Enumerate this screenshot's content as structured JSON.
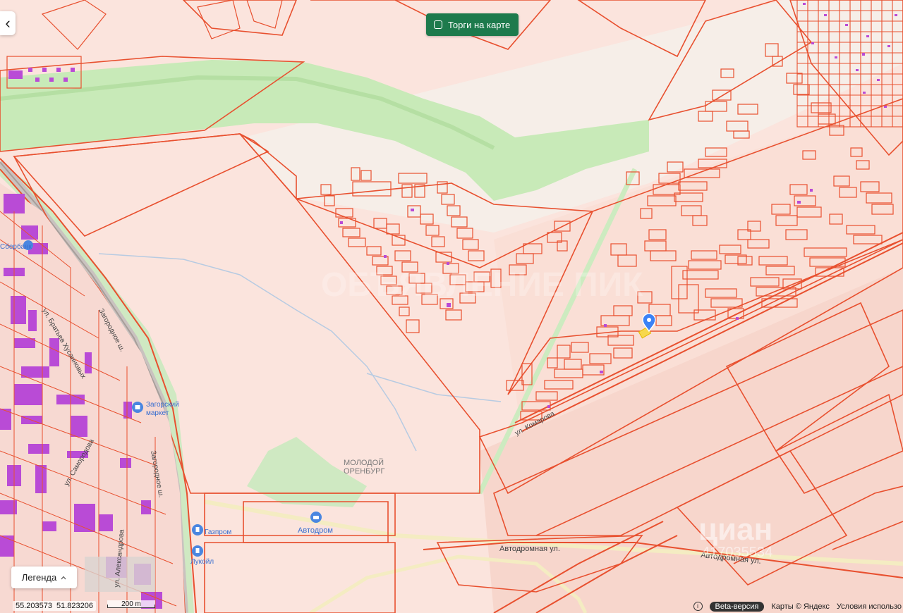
{
  "controls": {
    "auction_toggle_label": "Торги на карте",
    "legend_label": "Легенда",
    "back_symbol": "‹"
  },
  "status": {
    "lat": "55.203573",
    "lon": "51.823206",
    "scale_label": "200 m",
    "beta_label": "Beta-версия",
    "attribution": "Карты © Яндекс",
    "terms": "Условия использо"
  },
  "labels": {
    "district": [
      "МОЛОДОЙ",
      "ОРЕНБУРГ"
    ],
    "avtodrom": "Автодром",
    "avtodromnaya_1": "Автодромная ул.",
    "avtodromnaya_2": "Автодромная ул.",
    "komarova": "ул. Комарова",
    "zagorodnoe": "Загородное ш.",
    "zagorodnoe_2": "Загородное ш.",
    "bratsev": "ул. Братьев Хусаиновых",
    "aleksandrova": "ул. Александрова",
    "samorodova": "ул. Самородова",
    "zagorsky_1": "Загорский",
    "zagorsky_2": "маркет",
    "gazprom": "Газпром",
    "lukoil": "Лукойл",
    "bank": "Сбербанк",
    "cian": "циан",
    "cian_id": "417035534",
    "watermark": "ОБЪЯВЛЕНИЕ ПИК"
  },
  "icons": {
    "back": "chevron-left-icon",
    "checkbox": "checkbox-icon",
    "legend_arrow": "chevron-up-icon",
    "info": "info-icon",
    "marker": "map-pin-icon"
  },
  "colors": {
    "background": "#fbe4dd",
    "parcel_stroke": "#e8502f",
    "greenbelt": "#c8eab8",
    "building": "#b94bd6",
    "accent_green": "#1d7a4c",
    "marker_blue": "#3b82f6"
  }
}
